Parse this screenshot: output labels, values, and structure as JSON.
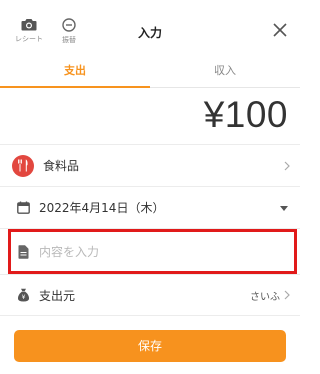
{
  "header": {
    "title": "入力",
    "receipt_label": "レシート",
    "transfer_label": "振替"
  },
  "tabs": [
    {
      "label": "支出",
      "active": true
    },
    {
      "label": "収入",
      "active": false
    }
  ],
  "amount": "¥100",
  "category": {
    "label": "食料品",
    "icon": "fork-knife-icon",
    "icon_color": "#e2473f"
  },
  "date": {
    "label": "2022年4月14日（木）"
  },
  "memo": {
    "value": "",
    "placeholder": "内容を入力"
  },
  "source": {
    "label": "支出元",
    "value": "さいふ"
  },
  "save_label": "保存",
  "colors": {
    "accent": "#f7921e",
    "highlight": "#e11a1a"
  }
}
